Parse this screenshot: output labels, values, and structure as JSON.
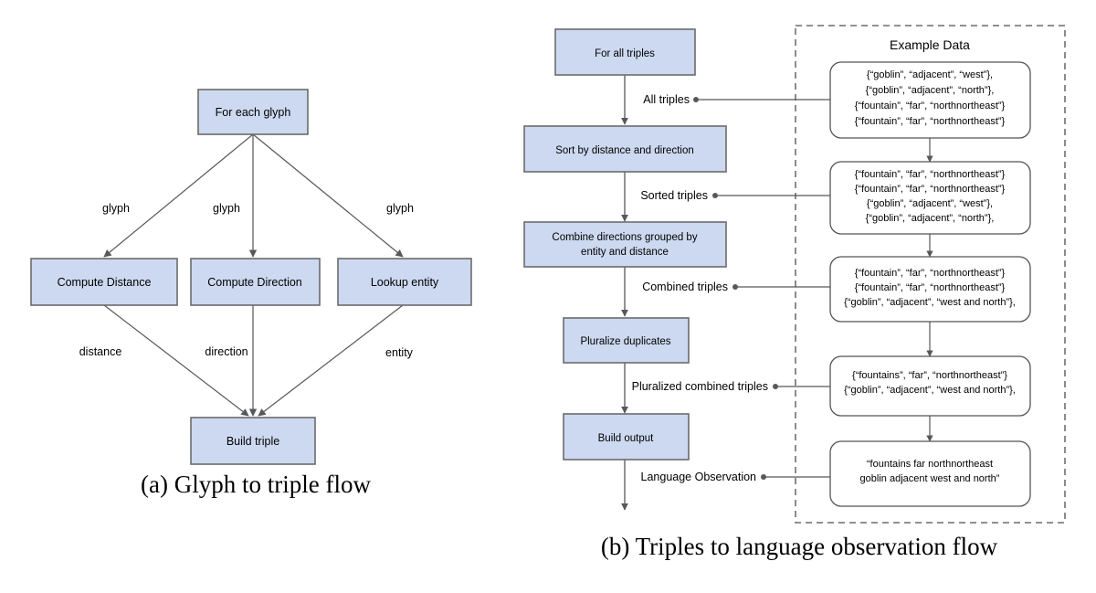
{
  "figure": {
    "caption_a": "(a) Glyph to triple flow",
    "caption_b": "(b) Triples to language observation flow",
    "colors": {
      "node_fill": "#ccd9f0",
      "node_stroke": "#6b6b6b",
      "edge_stroke": "#56585b",
      "panel_stroke": "#4d4d4d",
      "text": "#000000",
      "background": "#ffffff"
    }
  },
  "diagram_a": {
    "nodes": {
      "root": "For each glyph",
      "compute_distance": "Compute Distance",
      "compute_direction": "Compute Direction",
      "lookup_entity": "Lookup entity",
      "build_triple": "Build triple"
    },
    "edge_labels": {
      "glyph_left": "glyph",
      "glyph_middle": "glyph",
      "glyph_right": "glyph",
      "distance": "distance",
      "direction": "direction",
      "entity": "entity"
    }
  },
  "diagram_b": {
    "nodes": {
      "for_all_triples": "For all triples",
      "sort": "Sort by distance and direction",
      "combine_line1": "Combine directions grouped by",
      "combine_line2": "entity and distance",
      "pluralize": "Pluralize duplicates",
      "build_output": "Build output"
    },
    "edge_labels": {
      "all_triples": "All triples",
      "sorted_triples": "Sorted triples",
      "combined_triples": "Combined triples",
      "pluralized_combined_triples": "Pluralized combined triples",
      "language_observation": "Language Observation"
    },
    "example_panel": {
      "title": "Example Data",
      "boxes": [
        {
          "id": "all-triples-data",
          "lines": [
            "{“goblin”, “adjacent”, “west”},",
            "{“goblin”, “adjacent”, “north”},",
            "{“fountain”, “far”, “northnortheast”}",
            "{“fountain”, “far”, “northnortheast”}"
          ]
        },
        {
          "id": "sorted-triples-data",
          "lines": [
            "{“fountain”, “far”, “northnortheast”}",
            "{“fountain”, “far”, “northnortheast”}",
            "{“goblin”, “adjacent”, “west”},",
            "{“goblin”, “adjacent”, “north”},"
          ]
        },
        {
          "id": "combined-triples-data",
          "lines": [
            "{“fountain”, “far”, “northnortheast”}",
            "{“fountain”, “far”, “northnortheast”}",
            "{“goblin”, “adjacent”, “west and north”},"
          ]
        },
        {
          "id": "pluralized-triples-data",
          "lines": [
            "{“fountains”, “far”, “northnortheast”}",
            "{“goblin”, “adjacent”, “west and north”},"
          ]
        },
        {
          "id": "language-observation-data",
          "lines": [
            "“fountains far northnortheast",
            "goblin adjacent west and north”"
          ]
        }
      ]
    }
  }
}
